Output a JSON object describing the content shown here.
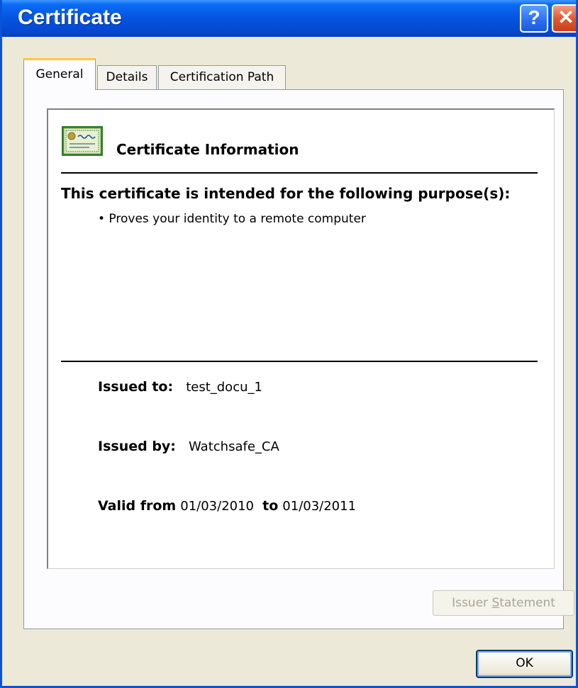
{
  "window": {
    "title": "Certificate",
    "help_label": "?",
    "close_label": "✕"
  },
  "tabs": [
    {
      "label": "General"
    },
    {
      "label": "Details"
    },
    {
      "label": "Certification Path"
    }
  ],
  "general": {
    "heading": "Certificate Information",
    "purpose_heading": "This certificate is intended for the following purpose(s):",
    "purposes": [
      "• Proves your identity to a remote computer"
    ],
    "issued_to_label": "Issued to:",
    "issued_to": "test_docu_1",
    "issued_by_label": "Issued by:",
    "issued_by": "Watchsafe_CA",
    "valid_from_label": "Valid from",
    "valid_from": "01/03/2010",
    "to_label": "to",
    "valid_to": "01/03/2011",
    "icon": "certificate-icon"
  },
  "buttons": {
    "issuer_statement_prefix": "Issuer ",
    "issuer_statement_access": "S",
    "issuer_statement_suffix": "tatement",
    "ok": "OK"
  }
}
